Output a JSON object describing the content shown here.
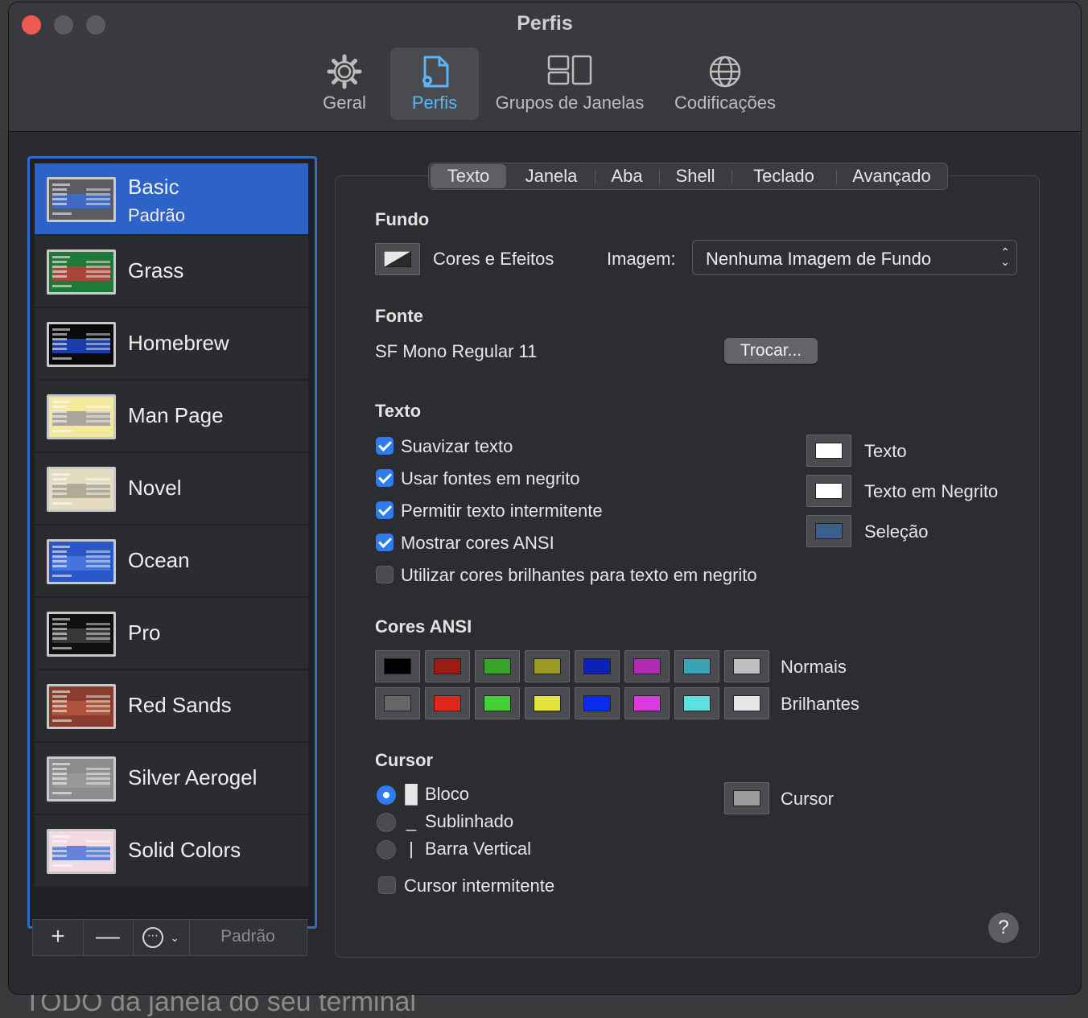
{
  "window": {
    "title": "Perfis"
  },
  "toolbar": [
    {
      "label": "Geral",
      "icon": "gear-icon"
    },
    {
      "label": "Perfis",
      "icon": "profile-doc-icon"
    },
    {
      "label": "Grupos de Janelas",
      "icon": "window-groups-icon"
    },
    {
      "label": "Codificações",
      "icon": "globe-icon"
    }
  ],
  "profiles": [
    {
      "name": "Basic",
      "sub": "Padrão",
      "bg": "#5a5c61",
      "bar": "#3b6bd6",
      "selected": true
    },
    {
      "name": "Grass",
      "bg": "#1f7a3a",
      "bar": "#c23c3c"
    },
    {
      "name": "Homebrew",
      "bg": "#0a0a0a",
      "bar": "#1f47c8"
    },
    {
      "name": "Man Page",
      "bg": "#f3e99a",
      "bar": "#9a9a9a"
    },
    {
      "name": "Novel",
      "bg": "#e5dcc0",
      "bar": "#a7a28c"
    },
    {
      "name": "Ocean",
      "bg": "#2a57c8",
      "bar": "#4b78e0"
    },
    {
      "name": "Pro",
      "bg": "#101010",
      "bar": "#3e3e3e"
    },
    {
      "name": "Red Sands",
      "bg": "#8a3d2e",
      "bar": "#b5573f"
    },
    {
      "name": "Silver Aerogel",
      "bg": "#8c8c8c",
      "bar": "#9a9a9a"
    },
    {
      "name": "Solid Colors",
      "bg": "#f3d9e2",
      "bar": "#4b72d8"
    }
  ],
  "sidebar_toolbar": {
    "add": "+",
    "remove": "—",
    "more": "⋯",
    "default": "Padrão"
  },
  "tabs": [
    "Texto",
    "Janela",
    "Aba",
    "Shell",
    "Teclado",
    "Avançado"
  ],
  "background": {
    "section": "Fundo",
    "effects_label": "Cores e Efeitos",
    "image_label": "Imagem:",
    "image_value": "Nenhuma Imagem de Fundo"
  },
  "font": {
    "section": "Fonte",
    "value": "SF Mono Regular 11",
    "change_button": "Trocar..."
  },
  "text": {
    "section": "Texto",
    "options": [
      {
        "label": "Suavizar texto",
        "checked": true
      },
      {
        "label": "Usar fontes em negrito",
        "checked": true
      },
      {
        "label": "Permitir texto intermitente",
        "checked": true
      },
      {
        "label": "Mostrar cores ANSI",
        "checked": true
      },
      {
        "label": "Utilizar cores brilhantes para texto em negrito",
        "checked": false
      }
    ],
    "colors": [
      {
        "label": "Texto",
        "color": "#ffffff"
      },
      {
        "label": "Texto em Negrito",
        "color": "#ffffff"
      },
      {
        "label": "Seleção",
        "color": "#3c5f8e"
      }
    ]
  },
  "ansi": {
    "section": "Cores ANSI",
    "normal_label": "Normais",
    "bright_label": "Brilhantes",
    "normal": [
      "#000000",
      "#9b1c14",
      "#37a329",
      "#9c9a25",
      "#0a22b8",
      "#b02ab2",
      "#3aa3b5",
      "#bfbfbf"
    ],
    "bright": [
      "#666666",
      "#e0271b",
      "#45d03a",
      "#e6e33c",
      "#0b2cf0",
      "#dd39e0",
      "#5ee0e3",
      "#e6e6e6"
    ]
  },
  "cursor": {
    "section": "Cursor",
    "options": [
      {
        "glyph": "█",
        "label": "Bloco",
        "selected": true
      },
      {
        "glyph": "_",
        "label": "Sublinhado",
        "selected": false
      },
      {
        "glyph": "|",
        "label": "Barra Vertical",
        "selected": false
      }
    ],
    "blink_label": "Cursor intermitente",
    "color_label": "Cursor",
    "color": "#9c9c9c"
  },
  "help": "?",
  "background_text": "TODO da janela do seu terminal"
}
